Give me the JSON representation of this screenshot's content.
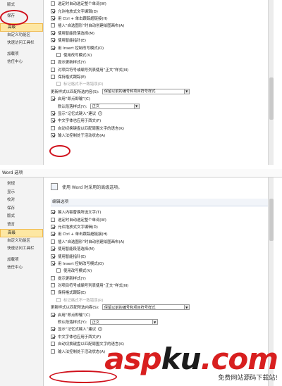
{
  "top_panel": {
    "sidebar": [
      {
        "label": "版式"
      },
      {
        "label": "保存"
      },
      {
        "label": "高级",
        "active": true
      },
      {
        "label": "自定义功能区"
      },
      {
        "label": "快速访问工具栏"
      },
      {
        "label": "加载项"
      },
      {
        "label": "信任中心"
      }
    ],
    "options": [
      {
        "label": "选定时自动选定整个单词(W)",
        "checked": false
      },
      {
        "label": "允许拖放式文字编辑(D)",
        "checked": true
      },
      {
        "label": "用 Ctrl + 单击跟踪超链接(H)",
        "checked": true
      },
      {
        "label": "插入“自选图形”时自动创建绘图画布(A)",
        "checked": false
      },
      {
        "label": "使用智能段落选择(M)",
        "checked": true
      },
      {
        "label": "使用智能指针(E)",
        "checked": true
      },
      {
        "label": "用 Insert 控制改写模式(O)",
        "checked": true
      },
      {
        "label": "使用改写模式(V)",
        "checked": false,
        "indent": true
      },
      {
        "label": "提示更新样式(Y)",
        "checked": false
      },
      {
        "label": "对项目符号或编号列表使用“正文”样式(N)",
        "checked": false
      },
      {
        "label": "保持格式跟踪(E)",
        "checked": false
      },
      {
        "label": "标记格式不一致错误(R)",
        "checked": false,
        "indent": true,
        "disabled": true
      }
    ],
    "update_style_label": "更新样式以匹配所选内容(S):",
    "update_style_value": "保留以前的编号和项目符号样式",
    "click_type_label": "启用“即点即输”(C)",
    "default_para_label": "默认段落样式(Y):",
    "default_para_value": "正文",
    "options2": [
      {
        "label": "显示“记忆式键入”建议",
        "checked": true
      },
      {
        "label": "中文字体也应用于西文(F)",
        "checked": true
      },
      {
        "label": "自动切换键盘以匹配周围文字的语言(K)",
        "checked": false
      }
    ],
    "last_partial": "输入法控制处于活动状态(A)"
  },
  "bottom_panel": {
    "title": "Word 选项",
    "sidebar": [
      {
        "label": "常规"
      },
      {
        "label": "显示"
      },
      {
        "label": "校对"
      },
      {
        "label": "保存"
      },
      {
        "label": "版式"
      },
      {
        "label": "语言"
      },
      {
        "label": "高级",
        "active": true
      },
      {
        "label": "自定义功能区"
      },
      {
        "label": "快速访问工具栏"
      },
      {
        "label": "加载项"
      },
      {
        "label": "信任中心"
      }
    ],
    "intro": "使用 Word 时采用的高级选项。",
    "section": "编辑选项",
    "options": [
      {
        "label": "键入内容替换所选文字(T)",
        "checked": true
      },
      {
        "label": "选定时自动选定整个单词(W)",
        "checked": false
      },
      {
        "label": "允许拖放式文字编辑(D)",
        "checked": true
      },
      {
        "label": "用 Ctrl + 单击跟踪超链接(H)",
        "checked": true
      },
      {
        "label": "插入“自选图形”时自动创建绘图画布(A)",
        "checked": false
      },
      {
        "label": "使用智能段落选择(M)",
        "checked": true
      },
      {
        "label": "使用智能指针(E)",
        "checked": true
      },
      {
        "label": "用 Insert 控制改写模式(O)",
        "checked": true
      },
      {
        "label": "使用改写模式(V)",
        "checked": false,
        "indent": true
      },
      {
        "label": "提示更新样式(Y)",
        "checked": false
      },
      {
        "label": "对项目符号或编号列表使用“正文”样式(N)",
        "checked": false
      },
      {
        "label": "保持格式跟踪(E)",
        "checked": false
      },
      {
        "label": "标记格式不一致错误(R)",
        "checked": false,
        "indent": true,
        "disabled": true
      }
    ],
    "update_style_label": "更新样式以匹配所选内容(S):",
    "update_style_value": "保留以前的编号和项目符号样式",
    "click_type_label": "启用“即点即输”(C)",
    "default_para_label": "默认段落样式(Y):",
    "default_para_value": "正文",
    "options2": [
      {
        "label": "显示“记忆式键入”建议",
        "checked": true
      },
      {
        "label": "中文字体也应用于西文(F)",
        "checked": true
      },
      {
        "label": "自动切换键盘以匹配周围文字的语言(K)",
        "checked": false
      }
    ],
    "ime_label": "输入法控制处于活动状态(A)"
  },
  "watermark": {
    "logo_red_1": "asp",
    "logo_dark": "ku",
    "logo_red_2": ".com",
    "subtitle": "免费网站源码下载站!"
  },
  "colors": {
    "highlight_ring": "#d0101b",
    "active_item": "#fde7a3"
  }
}
